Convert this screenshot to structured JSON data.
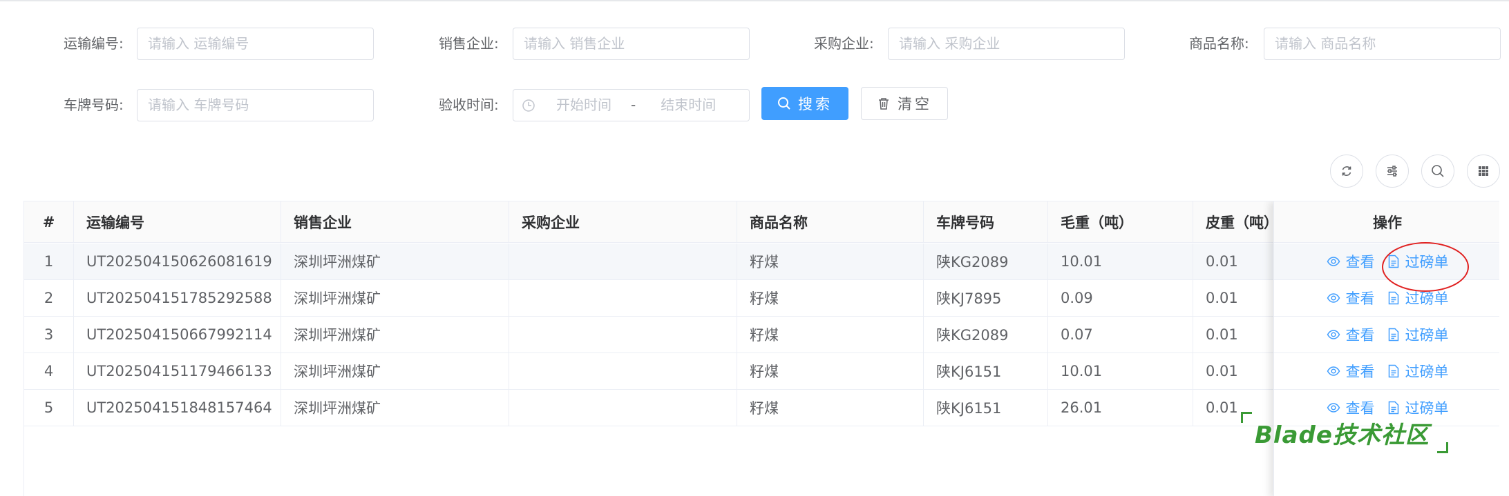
{
  "search": {
    "fields": [
      {
        "label": "运输编号:",
        "placeholder": "请输入 运输编号"
      },
      {
        "label": "销售企业:",
        "placeholder": "请输入 销售企业"
      },
      {
        "label": "采购企业:",
        "placeholder": "请输入 采购企业"
      },
      {
        "label": "商品名称:",
        "placeholder": "请输入 商品名称"
      },
      {
        "label": "车牌号码:",
        "placeholder": "请输入 车牌号码"
      }
    ],
    "date": {
      "label": "验收时间:",
      "start_placeholder": "开始时间",
      "separator": "-",
      "end_placeholder": "结束时间"
    },
    "search_button": "搜索",
    "clear_button": "清空"
  },
  "toolbar": [
    "refresh-icon",
    "filter-settings-icon",
    "search-icon",
    "column-grid-icon"
  ],
  "table": {
    "columns": [
      "#",
      "运输编号",
      "销售企业",
      "采购企业",
      "商品名称",
      "车牌号码",
      "毛重（吨）",
      "皮重（吨）",
      "操作"
    ],
    "rows": [
      [
        "1",
        "UT202504150626081619",
        "深圳坪洲煤矿",
        "",
        "籽煤",
        "陕KG2089",
        "10.01",
        "0.01"
      ],
      [
        "2",
        "UT202504151785292588",
        "深圳坪洲煤矿",
        "",
        "籽煤",
        "陕KJ7895",
        "0.09",
        "0.01"
      ],
      [
        "3",
        "UT202504150667992114",
        "深圳坪洲煤矿",
        "",
        "籽煤",
        "陕KG2089",
        "0.07",
        "0.01"
      ],
      [
        "4",
        "UT202504151179466133",
        "深圳坪洲煤矿",
        "",
        "籽煤",
        "陕KJ6151",
        "10.01",
        "0.01"
      ],
      [
        "5",
        "UT202504151848157464",
        "深圳坪洲煤矿",
        "",
        "籽煤",
        "陕KJ6151",
        "26.01",
        "0.01"
      ]
    ],
    "actions": {
      "view": "查看",
      "weigh": "过磅单"
    }
  },
  "watermark": "Blade技术社区",
  "colors": {
    "primary": "#409eff",
    "highlight": "#e02020",
    "watermark": "#3a9a35"
  }
}
